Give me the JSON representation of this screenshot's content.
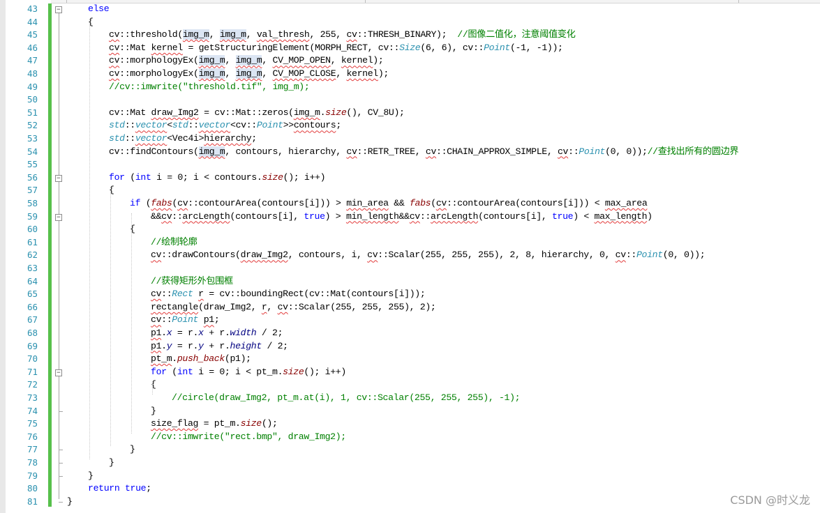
{
  "watermark": "CSDN @时义龙",
  "line_numbers": [
    "43",
    "44",
    "45",
    "46",
    "47",
    "48",
    "49",
    "50",
    "51",
    "52",
    "53",
    "54",
    "55",
    "56",
    "57",
    "58",
    "59",
    "60",
    "61",
    "62",
    "63",
    "64",
    "65",
    "66",
    "67",
    "68",
    "69",
    "70",
    "71",
    "72",
    "73",
    "74",
    "75",
    "76",
    "77",
    "78",
    "79",
    "80",
    "81"
  ],
  "code": [
    {
      "indent": 1,
      "tokens": [
        {
          "t": "else",
          "c": "kw"
        }
      ]
    },
    {
      "indent": 1,
      "tokens": [
        {
          "t": "{"
        }
      ]
    },
    {
      "indent": 2,
      "tokens": [
        {
          "t": "cv",
          "c": "sq"
        },
        {
          "t": "::threshold("
        },
        {
          "t": "img_m",
          "c": "hl sq"
        },
        {
          "t": ", "
        },
        {
          "t": "img_m",
          "c": "hl sq"
        },
        {
          "t": ", "
        },
        {
          "t": "val_thresh",
          "c": "sq"
        },
        {
          "t": ", 255, "
        },
        {
          "t": "cv",
          "c": "sq"
        },
        {
          "t": "::THRESH_BINARY);  "
        },
        {
          "t": "//图像二值化，注意阈值变化",
          "c": "cm"
        }
      ]
    },
    {
      "indent": 2,
      "tokens": [
        {
          "t": "cv",
          "c": "sq"
        },
        {
          "t": "::Mat "
        },
        {
          "t": "kernel",
          "c": "sq"
        },
        {
          "t": " = getStructuringElement(MORPH_RECT, "
        },
        {
          "t": "cv::"
        },
        {
          "t": "Size",
          "c": "ty"
        },
        {
          "t": "(6, 6), "
        },
        {
          "t": "cv::"
        },
        {
          "t": "Point",
          "c": "ty"
        },
        {
          "t": "(-1, -1));"
        }
      ]
    },
    {
      "indent": 2,
      "tokens": [
        {
          "t": "cv",
          "c": "sq"
        },
        {
          "t": "::morphologyEx("
        },
        {
          "t": "img_m",
          "c": "hl sq"
        },
        {
          "t": ", "
        },
        {
          "t": "img_m",
          "c": "hl sq"
        },
        {
          "t": ", "
        },
        {
          "t": "CV_MOP_OPEN",
          "c": "sq"
        },
        {
          "t": ", "
        },
        {
          "t": "kernel",
          "c": "sq"
        },
        {
          "t": ");"
        }
      ]
    },
    {
      "indent": 2,
      "tokens": [
        {
          "t": "cv",
          "c": "sq"
        },
        {
          "t": "::morphologyEx("
        },
        {
          "t": "img_m",
          "c": "hl sq"
        },
        {
          "t": ", "
        },
        {
          "t": "img_m",
          "c": "hl sq"
        },
        {
          "t": ", "
        },
        {
          "t": "CV_MOP_CLOSE",
          "c": "sq"
        },
        {
          "t": ", "
        },
        {
          "t": "kernel",
          "c": "sq"
        },
        {
          "t": ");"
        }
      ]
    },
    {
      "indent": 2,
      "tokens": [
        {
          "t": "//cv::imwrite(\"threshold.tif\", img_m);",
          "c": "cm"
        }
      ]
    },
    {
      "indent": 0,
      "tokens": []
    },
    {
      "indent": 2,
      "tokens": [
        {
          "t": "cv::Mat "
        },
        {
          "t": "draw_Img2",
          "c": "sq"
        },
        {
          "t": " = cv::Mat::zeros("
        },
        {
          "t": "img_m",
          "c": "sq"
        },
        {
          "t": "."
        },
        {
          "t": "size",
          "c": "fn"
        },
        {
          "t": "(), CV_8U);"
        }
      ]
    },
    {
      "indent": 2,
      "tokens": [
        {
          "t": "std",
          "c": "ty"
        },
        {
          "t": "::"
        },
        {
          "t": "vector",
          "c": "ty sq"
        },
        {
          "t": "<"
        },
        {
          "t": "std",
          "c": "ty"
        },
        {
          "t": "::"
        },
        {
          "t": "vector",
          "c": "ty sq"
        },
        {
          "t": "<cv::"
        },
        {
          "t": "Point",
          "c": "ty"
        },
        {
          "t": ">>"
        },
        {
          "t": "contours",
          "c": "sq"
        },
        {
          "t": ";"
        }
      ]
    },
    {
      "indent": 2,
      "tokens": [
        {
          "t": "std",
          "c": "ty"
        },
        {
          "t": "::"
        },
        {
          "t": "vector",
          "c": "ty sq"
        },
        {
          "t": "<Vec4i>"
        },
        {
          "t": "hierarchy",
          "c": "sq"
        },
        {
          "t": ";"
        }
      ]
    },
    {
      "indent": 2,
      "tokens": [
        {
          "t": "cv::findContours("
        },
        {
          "t": "img_m",
          "c": "hl sq"
        },
        {
          "t": ", contours, hierarchy, "
        },
        {
          "t": "cv",
          "c": "sq"
        },
        {
          "t": "::RETR_TREE, "
        },
        {
          "t": "cv",
          "c": "sq"
        },
        {
          "t": "::CHAIN_APPROX_SIMPLE, "
        },
        {
          "t": "cv",
          "c": "sq"
        },
        {
          "t": "::"
        },
        {
          "t": "Point",
          "c": "ty"
        },
        {
          "t": "(0, 0));"
        },
        {
          "t": "//查找出所有的圆边界",
          "c": "cm"
        }
      ]
    },
    {
      "indent": 0,
      "tokens": []
    },
    {
      "indent": 2,
      "tokens": [
        {
          "t": "for",
          "c": "kw"
        },
        {
          "t": " ("
        },
        {
          "t": "int",
          "c": "kw"
        },
        {
          "t": " i = 0; i < contours."
        },
        {
          "t": "size",
          "c": "fn"
        },
        {
          "t": "(); i++)"
        }
      ]
    },
    {
      "indent": 2,
      "tokens": [
        {
          "t": "{"
        }
      ]
    },
    {
      "indent": 3,
      "tokens": [
        {
          "t": "if",
          "c": "kw"
        },
        {
          "t": " ("
        },
        {
          "t": "fabs",
          "c": "fn sq"
        },
        {
          "t": "("
        },
        {
          "t": "cv",
          "c": "sq"
        },
        {
          "t": "::contourArea(contours[i])) > "
        },
        {
          "t": "min_area",
          "c": "sq"
        },
        {
          "t": " && "
        },
        {
          "t": "fabs",
          "c": "fn"
        },
        {
          "t": "("
        },
        {
          "t": "cv",
          "c": "sq"
        },
        {
          "t": "::contourArea(contours[i])) < "
        },
        {
          "t": "max_area",
          "c": "sq"
        }
      ]
    },
    {
      "indent": 4,
      "tokens": [
        {
          "t": "&&"
        },
        {
          "t": "cv",
          "c": "sq"
        },
        {
          "t": "::"
        },
        {
          "t": "arcLength",
          "c": "sq"
        },
        {
          "t": "(contours[i], "
        },
        {
          "t": "true",
          "c": "kw"
        },
        {
          "t": ") > "
        },
        {
          "t": "min_length",
          "c": "sq"
        },
        {
          "t": "&&"
        },
        {
          "t": "cv",
          "c": "sq"
        },
        {
          "t": "::"
        },
        {
          "t": "arcLength",
          "c": "sq"
        },
        {
          "t": "(contours[i], "
        },
        {
          "t": "true",
          "c": "kw"
        },
        {
          "t": ") < "
        },
        {
          "t": "max_length",
          "c": "sq"
        },
        {
          "t": ")"
        }
      ]
    },
    {
      "indent": 3,
      "tokens": [
        {
          "t": "{"
        }
      ]
    },
    {
      "indent": 4,
      "tokens": [
        {
          "t": "//绘制轮廓",
          "c": "cm"
        }
      ]
    },
    {
      "indent": 4,
      "tokens": [
        {
          "t": "cv",
          "c": "sq"
        },
        {
          "t": "::drawContours("
        },
        {
          "t": "draw_Img2",
          "c": "sq"
        },
        {
          "t": ", contours, i, "
        },
        {
          "t": "cv",
          "c": "sq"
        },
        {
          "t": "::Scalar(255, 255, 255), 2, 8, hierarchy, 0, "
        },
        {
          "t": "cv",
          "c": "sq"
        },
        {
          "t": "::"
        },
        {
          "t": "Point",
          "c": "ty"
        },
        {
          "t": "(0, 0));"
        }
      ]
    },
    {
      "indent": 0,
      "tokens": []
    },
    {
      "indent": 4,
      "tokens": [
        {
          "t": "//获得矩形外包围框",
          "c": "cm"
        }
      ]
    },
    {
      "indent": 4,
      "tokens": [
        {
          "t": "cv",
          "c": "sq"
        },
        {
          "t": "::"
        },
        {
          "t": "Rect",
          "c": "ty"
        },
        {
          "t": " "
        },
        {
          "t": "r",
          "c": "sq"
        },
        {
          "t": " = cv::boundingRect(cv::Mat(contours[i]));"
        }
      ]
    },
    {
      "indent": 4,
      "tokens": [
        {
          "t": "rectangle",
          "c": "sq"
        },
        {
          "t": "(draw_Img2, "
        },
        {
          "t": "r",
          "c": "sq"
        },
        {
          "t": ", "
        },
        {
          "t": "cv",
          "c": "sq"
        },
        {
          "t": "::Scalar(255, 255, 255), 2);"
        }
      ]
    },
    {
      "indent": 4,
      "tokens": [
        {
          "t": "cv",
          "c": "sq"
        },
        {
          "t": "::"
        },
        {
          "t": "Point",
          "c": "ty"
        },
        {
          "t": " "
        },
        {
          "t": "p1",
          "c": "sq"
        },
        {
          "t": ";"
        }
      ]
    },
    {
      "indent": 4,
      "tokens": [
        {
          "t": "p1",
          "c": "sq"
        },
        {
          "t": "."
        },
        {
          "t": "x",
          "c": "mb"
        },
        {
          "t": " = r."
        },
        {
          "t": "x",
          "c": "mb"
        },
        {
          "t": " + r."
        },
        {
          "t": "width",
          "c": "mb"
        },
        {
          "t": " / 2;"
        }
      ]
    },
    {
      "indent": 4,
      "tokens": [
        {
          "t": "p1",
          "c": "sq"
        },
        {
          "t": "."
        },
        {
          "t": "y",
          "c": "mb"
        },
        {
          "t": " = r."
        },
        {
          "t": "y",
          "c": "mb"
        },
        {
          "t": " + r."
        },
        {
          "t": "height",
          "c": "mb"
        },
        {
          "t": " / 2;"
        }
      ]
    },
    {
      "indent": 4,
      "tokens": [
        {
          "t": "pt_m",
          "c": "sq"
        },
        {
          "t": "."
        },
        {
          "t": "push_back",
          "c": "fn"
        },
        {
          "t": "(p1);"
        }
      ]
    },
    {
      "indent": 4,
      "tokens": [
        {
          "t": "for",
          "c": "kw"
        },
        {
          "t": " ("
        },
        {
          "t": "int",
          "c": "kw"
        },
        {
          "t": " i = 0; i < pt_m."
        },
        {
          "t": "size",
          "c": "fn"
        },
        {
          "t": "(); i++)"
        }
      ]
    },
    {
      "indent": 4,
      "tokens": [
        {
          "t": "{"
        }
      ]
    },
    {
      "indent": 5,
      "tokens": [
        {
          "t": "//circle(draw_Img2, pt_m.at(i), 1, cv::Scalar(255, 255, 255), -1);",
          "c": "cm"
        }
      ]
    },
    {
      "indent": 4,
      "tokens": [
        {
          "t": "}"
        }
      ]
    },
    {
      "indent": 4,
      "tokens": [
        {
          "t": "size_flag",
          "c": "sq"
        },
        {
          "t": " = pt_m."
        },
        {
          "t": "size",
          "c": "fn"
        },
        {
          "t": "();"
        }
      ]
    },
    {
      "indent": 4,
      "tokens": [
        {
          "t": "//cv::imwrite(\"rect.bmp\", draw_Img2);",
          "c": "cm"
        }
      ]
    },
    {
      "indent": 3,
      "tokens": [
        {
          "t": "}"
        }
      ]
    },
    {
      "indent": 2,
      "tokens": [
        {
          "t": "}"
        }
      ]
    },
    {
      "indent": 1,
      "tokens": [
        {
          "t": "}"
        }
      ]
    },
    {
      "indent": 1,
      "tokens": [
        {
          "t": "return",
          "c": "kw"
        },
        {
          "t": " "
        },
        {
          "t": "true",
          "c": "kw"
        },
        {
          "t": ";"
        }
      ]
    },
    {
      "indent": 0,
      "tokens": [
        {
          "t": "}"
        }
      ]
    }
  ],
  "fold_markers": [
    {
      "line": "43",
      "symbol": "−"
    },
    {
      "line": "56",
      "symbol": "−"
    },
    {
      "line": "59",
      "symbol": "−"
    },
    {
      "line": "71",
      "symbol": "−"
    }
  ],
  "colors": {
    "keyword": "#0000ff",
    "comment": "#008000",
    "type": "#2b91af",
    "line_number": "#2b91af",
    "change_bar": "#57c04b"
  }
}
